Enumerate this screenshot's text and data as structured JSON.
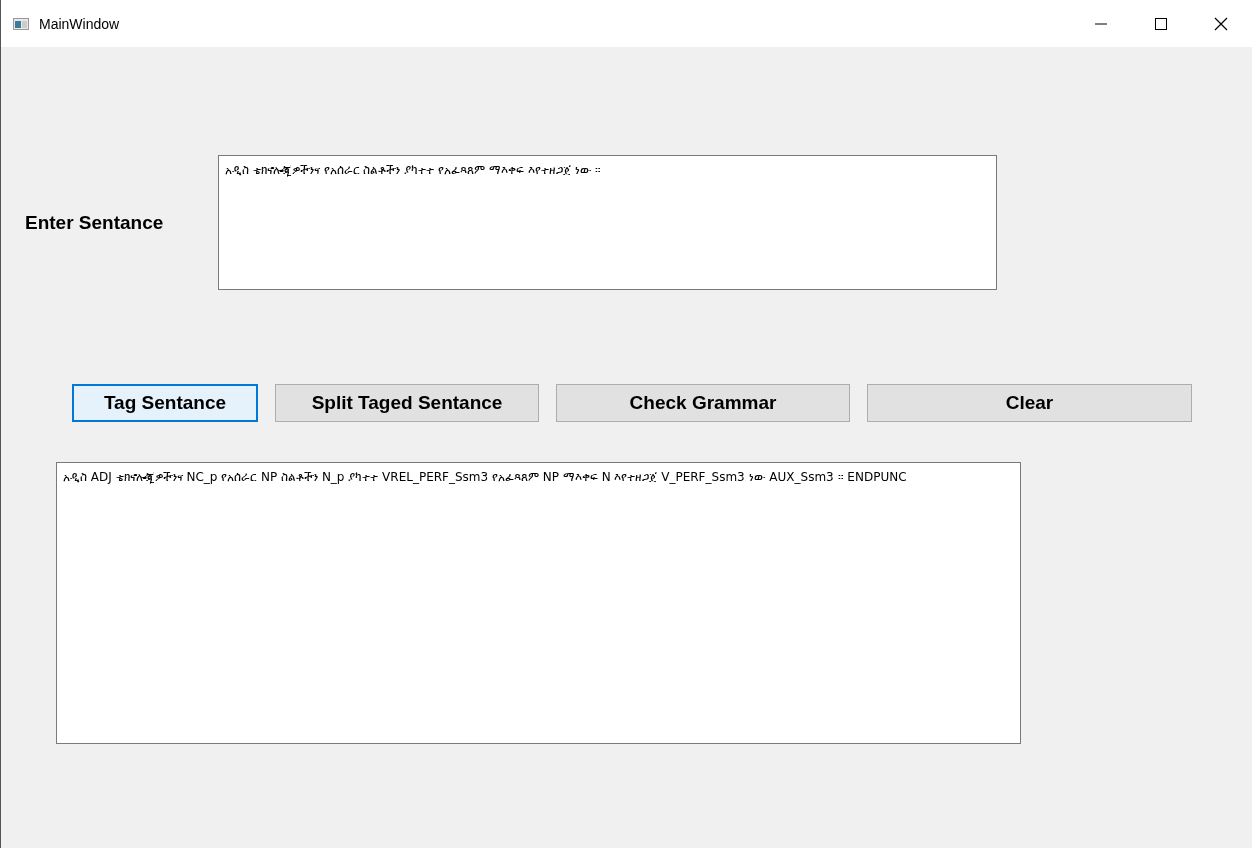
{
  "window": {
    "title": "MainWindow"
  },
  "sentence_input": {
    "label": "Enter Sentance",
    "value": "አዲስ ቴክኖሎጂዎችንና የአሰራር ስልቶችን ያካተተ የአፈጻጸም ማእቀፍ እየተዘጋጀ ነው ።"
  },
  "buttons": [
    {
      "label": "Tag Sentance",
      "focused": true
    },
    {
      "label": "Split Taged Sentance",
      "focused": false
    },
    {
      "label": "Check Grammar",
      "focused": false
    },
    {
      "label": "Clear",
      "focused": false
    }
  ],
  "output": {
    "value": "አዲስ ADJ ቴክኖሎጂዎችንና NC_p የአሰራር NP ስልቶችን N_p ያካተተ VREL_PERF_Ssm3 የአፈጻጸም NP ማእቀፍ N እየተዘጋጀ V_PERF_Ssm3 ነው AUX_Ssm3 ። ENDPUNC"
  }
}
